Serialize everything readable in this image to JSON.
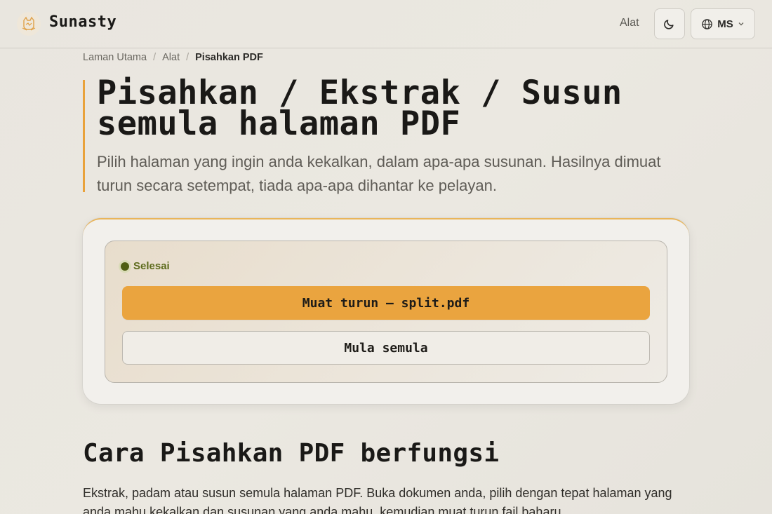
{
  "header": {
    "brand": "Sunasty",
    "tools_link": "Alat",
    "language": "MS"
  },
  "breadcrumb": {
    "home": "Laman Utama",
    "tools": "Alat",
    "current": "Pisahkan PDF"
  },
  "hero": {
    "title": "Pisahkan / Ekstrak / Susun semula halaman PDF",
    "subtitle": "Pilih halaman yang ingin anda kekalkan, dalam apa-apa susunan. Hasilnya dimuat turun secara setempat, tiada apa-apa dihantar ke pelayan."
  },
  "result": {
    "status": "Selesai",
    "download_label": "Muat turun — split.pdf",
    "restart_label": "Mula semula"
  },
  "section": {
    "title": "Cara Pisahkan PDF berfungsi",
    "body": "Ekstrak, padam atau susun semula halaman PDF. Buka dokumen anda, pilih dengan tepat halaman yang anda mahu kekalkan dan susunan yang anda mahu, kemudian muat turun fail baharu."
  },
  "colors": {
    "accent": "#eaa43f",
    "status_green": "#5d6b1c"
  },
  "icons": [
    "logo-icon",
    "moon-icon",
    "globe-icon",
    "chevron-down-icon"
  ]
}
